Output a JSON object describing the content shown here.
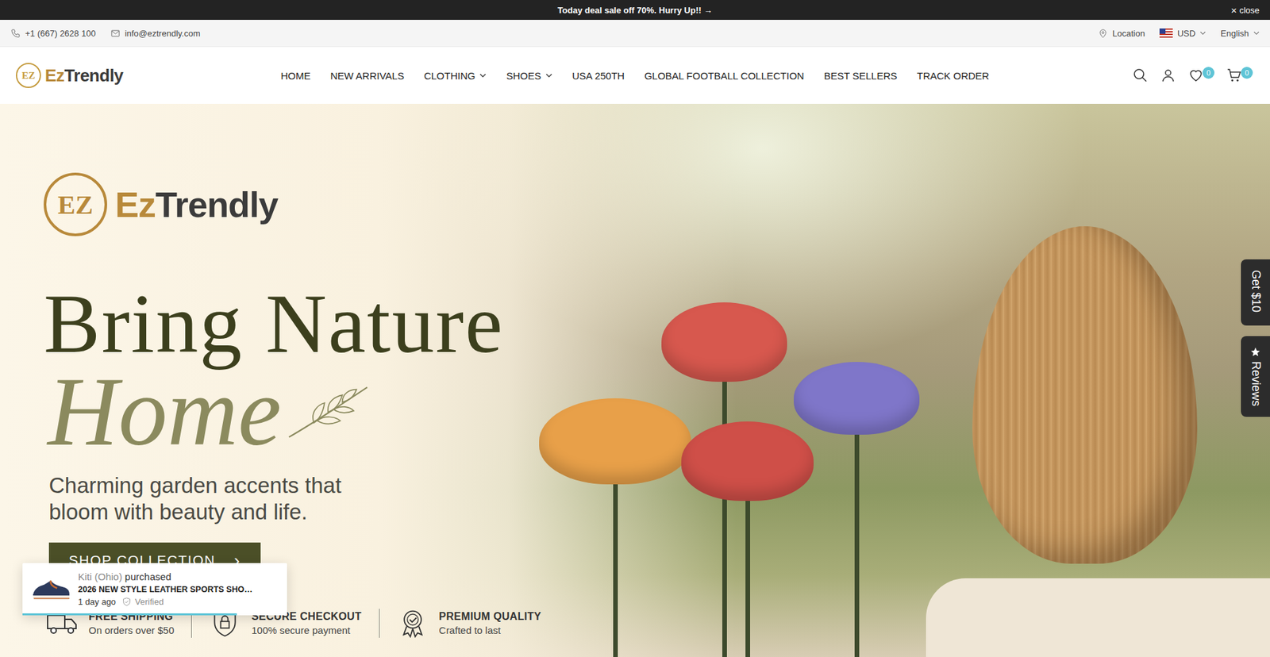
{
  "announcement": {
    "text": "Today deal sale off 70%. Hurry Up!! →",
    "close_icon": "×",
    "close": "close"
  },
  "contact": {
    "phone": "+1 (667) 2628 100",
    "email": "info@eztrendly.com"
  },
  "utilities": {
    "location": "Location",
    "currency": "USD",
    "language": "English"
  },
  "logo": {
    "mark": "EZ",
    "prefix": "Ez",
    "suffix": "Trendly"
  },
  "nav": [
    {
      "label": "HOME",
      "has_menu": false
    },
    {
      "label": "NEW ARRIVALS",
      "has_menu": false
    },
    {
      "label": "CLOTHING",
      "has_menu": true
    },
    {
      "label": "SHOES",
      "has_menu": true
    },
    {
      "label": "USA 250TH",
      "has_menu": false
    },
    {
      "label": "GLOBAL FOOTBALL COLLECTION",
      "has_menu": false
    },
    {
      "label": "BEST SELLERS",
      "has_menu": false
    },
    {
      "label": "TRACK ORDER",
      "has_menu": false
    }
  ],
  "header_icons": {
    "wishlist_count": "0",
    "cart_count": "0"
  },
  "hero": {
    "title": "Bring Nature",
    "script": "Home",
    "subtitle_lines": [
      "Charming garden accents that",
      "bloom with beauty and life."
    ],
    "button": "SHOP COLLECTION",
    "button_icon": "›"
  },
  "features": [
    {
      "kind": "truck",
      "title": "FREE SHIPPING",
      "subtitle": "On orders over $50"
    },
    {
      "kind": "lock",
      "title": "SECURE CHECKOUT",
      "subtitle": "100% secure payment"
    },
    {
      "kind": "award",
      "title": "PREMIUM QUALITY",
      "subtitle": "Crafted to last"
    }
  ],
  "side_tabs": [
    {
      "kind": "plain",
      "label": "Get $10"
    },
    {
      "kind": "star",
      "label": "Reviews"
    }
  ],
  "purchase_toast": {
    "customer": "Kiti (Ohio)",
    "action": "purchased",
    "product": "2026 NEW STYLE LEATHER SPORTS SHO…",
    "time": "1 day ago",
    "badge": "Verified",
    "progress": 0.81
  }
}
